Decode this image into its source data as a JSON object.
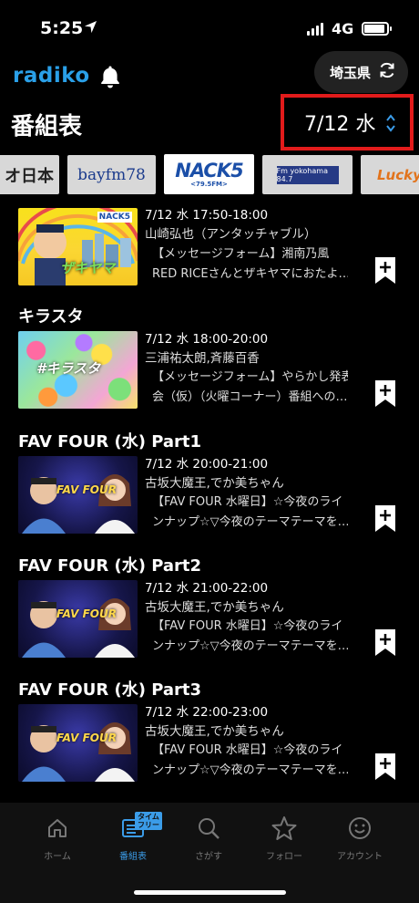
{
  "status_bar": {
    "time": "5:25",
    "network": "4G"
  },
  "header": {
    "logo": "radiko",
    "prefecture_label": "埼玉県",
    "title": "番組表",
    "date": "7/12 水"
  },
  "stations": [
    {
      "label": "オ日本"
    },
    {
      "label": "bayfm78"
    },
    {
      "label": "NACK5",
      "sub": "<79.5FM>"
    },
    {
      "label": "Fm yokohama 84.7"
    },
    {
      "label": "LuckyF"
    }
  ],
  "programs": [
    {
      "title": "",
      "time": "7/12 水 17:50-18:00",
      "host": "山崎弘也（アンタッチャブル）",
      "desc_line1": "【メッセージフォーム】湘南乃風",
      "desc_line2": "RED RICEさんとザキヤマにおたよ…",
      "thumb_text": "ザキヤマ",
      "thumb_logo": "NACK5"
    },
    {
      "title": "キラスタ",
      "time": "7/12 水 18:00-20:00",
      "host": "三浦祐太朗,斉藤百香",
      "desc_line1": "【メッセージフォーム】やらかし発表",
      "desc_line2": "会（仮）（火曜コーナー）番組への…",
      "thumb_text": "#キラスタ"
    },
    {
      "title": "FAV FOUR (水) Part1",
      "time": "7/12 水 20:00-21:00",
      "host": "古坂大魔王,でか美ちゃん",
      "desc_line1": "【FAV FOUR 水曜日】☆今夜のライ",
      "desc_line2": "ンナップ☆▽今夜のテーマテーマを…",
      "thumb_text": "FAV FOUR"
    },
    {
      "title": "FAV FOUR (水) Part2",
      "time": "7/12 水 21:00-22:00",
      "host": "古坂大魔王,でか美ちゃん",
      "desc_line1": "【FAV FOUR 水曜日】☆今夜のライ",
      "desc_line2": "ンナップ☆▽今夜のテーマテーマを…",
      "thumb_text": "FAV FOUR"
    },
    {
      "title": "FAV FOUR (水) Part3",
      "time": "7/12 水 22:00-23:00",
      "host": "古坂大魔王,でか美ちゃん",
      "desc_line1": "【FAV FOUR 水曜日】☆今夜のライ",
      "desc_line2": "ンナップ☆▽今夜のテーマテーマを…",
      "thumb_text": "FAV FOUR"
    }
  ],
  "tabbar": {
    "items": [
      {
        "label": "ホーム",
        "icon": "home-icon"
      },
      {
        "label": "番組表",
        "icon": "schedule-icon",
        "badge_line1": "タイム",
        "badge_line2": "フリー"
      },
      {
        "label": "さがす",
        "icon": "search-icon"
      },
      {
        "label": "フォロー",
        "icon": "star-icon"
      },
      {
        "label": "アカウント",
        "icon": "smiley-icon"
      }
    ]
  },
  "colors": {
    "accent": "#2aa0e8",
    "highlight_border": "#e21b1b",
    "background": "#000000"
  }
}
